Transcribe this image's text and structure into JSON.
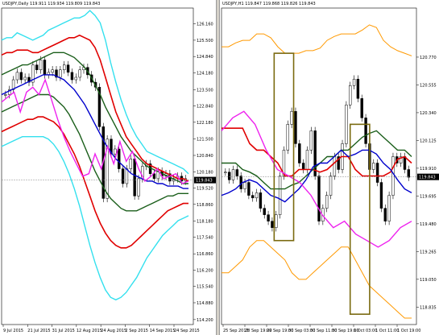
{
  "colors": {
    "background": "#ffffff",
    "candle": "#000000",
    "red": "#e00000",
    "darkred": "#cc0000",
    "green": "#1a5e1a",
    "blue": "#0000cc",
    "cyan": "#33e0ee",
    "magenta": "#ee22ee",
    "orange": "#ff9900",
    "olive": "#7a6a10",
    "grid": "#e6e6e6"
  },
  "chart_data": [
    {
      "type": "line",
      "title": "USDJPY,Daily  119.911 119.934 119.809 119.843",
      "x_labels": [
        "9 Jul 2015",
        "21 Jul 2015",
        "31 Jul 2015",
        "12 Aug 2015",
        "24 Aug 2015",
        "2 Sep 2015",
        "14 Sep 2015",
        "24 Sep 2015"
      ],
      "y_ticks": [
        "126.160",
        "125.500",
        "124.840",
        "124.180",
        "123.500",
        "122.840",
        "122.180",
        "121.500",
        "120.840",
        "120.180",
        "119.843",
        "119.520",
        "118.860",
        "118.180",
        "117.540",
        "116.860",
        "116.200",
        "115.540",
        "114.880",
        "114.200"
      ],
      "ylim": [
        114.0,
        126.8
      ],
      "current_price": "119.843",
      "close_series": [
        123.3,
        123.5,
        123.9,
        124.2,
        123.9,
        124.0,
        123.8,
        124.5,
        124.3,
        124.7,
        124.1,
        124.2,
        124.3,
        124.0,
        124.3,
        124.5,
        124.2,
        123.9,
        124.0,
        124.3,
        124.4,
        124.1,
        123.8,
        123.6,
        122.0,
        119.1,
        121.5,
        120.9,
        121.1,
        120.3,
        119.7,
        120.3,
        120.7,
        119.2,
        119.9,
        120.4,
        120.5,
        120.1,
        119.9,
        120.2,
        120.0,
        120.1,
        119.8,
        119.9,
        120.0,
        119.8,
        119.9
      ],
      "series": [
        {
          "name": "",
          "color_key": "cyan",
          "values": [
            125.5,
            125.6,
            125.6,
            125.8,
            125.7,
            125.6,
            125.5,
            125.6,
            125.7,
            125.9,
            126.0,
            126.1,
            126.2,
            126.3,
            126.4,
            126.4,
            126.5,
            126.7,
            126.5,
            126.2,
            125.5,
            124.6,
            123.8,
            123.1,
            122.5,
            122.0,
            121.6,
            121.3,
            121.0,
            120.9,
            120.8,
            120.7,
            120.6,
            120.5,
            120.4,
            120.3,
            120.1
          ]
        },
        {
          "name": "",
          "color_key": "red",
          "values": [
            124.9,
            125.0,
            125.0,
            125.1,
            125.1,
            125.1,
            125.0,
            125.0,
            125.1,
            125.2,
            125.3,
            125.4,
            125.5,
            125.6,
            125.6,
            125.7,
            125.6,
            125.5,
            125.2,
            124.7,
            124.0,
            123.3,
            122.6,
            122.1,
            121.6,
            121.3,
            121.0,
            120.7,
            120.5,
            120.4,
            120.3,
            120.2,
            120.1,
            120.0,
            119.9,
            119.9,
            119.8
          ]
        },
        {
          "name": "",
          "color_key": "green",
          "values": [
            124.1,
            124.2,
            124.3,
            124.4,
            124.5,
            124.5,
            124.6,
            124.7,
            124.8,
            124.9,
            125.0,
            125.0,
            125.0,
            124.9,
            124.8,
            124.6,
            124.4,
            124.1,
            123.7,
            123.3,
            122.8,
            122.4,
            122.0,
            121.6,
            121.3,
            121.0,
            120.8,
            120.6,
            120.4,
            120.3,
            120.2,
            120.1,
            120.0,
            119.9,
            119.8,
            119.7,
            119.7
          ]
        },
        {
          "name": "",
          "color_key": "blue",
          "values": [
            123.3,
            123.4,
            123.5,
            123.6,
            123.7,
            123.8,
            123.9,
            124.0,
            124.1,
            124.1,
            124.1,
            124.0,
            123.9,
            123.7,
            123.5,
            123.2,
            122.9,
            122.5,
            122.1,
            121.7,
            121.3,
            121.0,
            120.7,
            120.5,
            120.3,
            120.1,
            120.0,
            119.9,
            119.8,
            119.8,
            119.7,
            119.7,
            119.6,
            119.6,
            119.6,
            119.5,
            119.5
          ]
        },
        {
          "name": "",
          "color_key": "green",
          "values": [
            122.6,
            122.7,
            122.8,
            122.9,
            123.0,
            123.1,
            123.2,
            123.3,
            123.3,
            123.3,
            123.2,
            123.0,
            122.8,
            122.5,
            122.1,
            121.7,
            121.2,
            120.7,
            120.2,
            119.8,
            119.4,
            119.1,
            118.9,
            118.7,
            118.6,
            118.6,
            118.6,
            118.7,
            118.8,
            118.9,
            119.0,
            119.1,
            119.2,
            119.2,
            119.3,
            119.3,
            119.3
          ]
        },
        {
          "name": "",
          "color_key": "red",
          "values": [
            121.8,
            121.9,
            122.0,
            122.1,
            122.2,
            122.3,
            122.3,
            122.4,
            122.4,
            122.3,
            122.2,
            122.0,
            121.7,
            121.3,
            120.9,
            120.4,
            119.8,
            119.2,
            118.6,
            118.1,
            117.7,
            117.4,
            117.2,
            117.1,
            117.1,
            117.2,
            117.4,
            117.6,
            117.8,
            118.0,
            118.2,
            118.4,
            118.6,
            118.7,
            118.8,
            118.9,
            118.9
          ]
        },
        {
          "name": "",
          "color_key": "cyan",
          "values": [
            121.2,
            121.3,
            121.4,
            121.5,
            121.6,
            121.6,
            121.6,
            121.6,
            121.6,
            121.5,
            121.3,
            121.0,
            120.6,
            120.1,
            119.5,
            118.8,
            118.0,
            117.2,
            116.5,
            115.9,
            115.4,
            115.1,
            115.0,
            115.1,
            115.3,
            115.6,
            115.9,
            116.3,
            116.7,
            117.0,
            117.3,
            117.6,
            117.8,
            118.0,
            118.2,
            118.3,
            118.4
          ]
        },
        {
          "name": "",
          "color_key": "magenta",
          "values": [
            123.0,
            123.2,
            123.4,
            122.6,
            123.4,
            123.6,
            123.3,
            123.9,
            123.1,
            122.3,
            121.6,
            121.0,
            120.5,
            120.0,
            120.1,
            120.9,
            120.3,
            121.2,
            120.5,
            121.4,
            120.6,
            121.0,
            120.3,
            119.8,
            120.0,
            120.3,
            119.9,
            120.0,
            120.1,
            119.7,
            119.8
          ]
        }
      ]
    },
    {
      "type": "line",
      "title": "USDJPY,H1  119.847 119.868 119.826 119.843",
      "x_labels": [
        "25 Sep 2015",
        "28 Sep 19:00",
        "29 Sep 19:00",
        "30 Sep 03:00",
        "30 Sep 11:00",
        "30 Sep 19:00",
        "1 Oct 03:00",
        "1 Oct 11:00",
        "1 Oct 19:00"
      ],
      "y_ticks": [
        "120.770",
        "120.555",
        "120.340",
        "120.125",
        "119.910",
        "119.843",
        "119.695",
        "119.480",
        "119.265",
        "119.050",
        "118.835"
      ],
      "ylim": [
        118.7,
        121.15
      ],
      "current_price": "119.843",
      "close_series": [
        119.88,
        119.82,
        119.9,
        119.85,
        119.75,
        119.8,
        119.7,
        119.68,
        119.72,
        119.6,
        119.55,
        119.5,
        119.45,
        119.55,
        119.85,
        120.05,
        120.25,
        120.35,
        120.1,
        119.95,
        119.9,
        120.05,
        120.2,
        119.85,
        119.5,
        119.6,
        119.7,
        119.85,
        120.0,
        119.9,
        120.1,
        120.4,
        120.55,
        120.6,
        120.45,
        120.3,
        120.1,
        119.9,
        119.95,
        119.8,
        119.6,
        119.5,
        119.7,
        120.0,
        119.95,
        120.0,
        119.9,
        119.84
      ],
      "series": [
        {
          "name": "",
          "color_key": "orange",
          "values": [
            120.85,
            120.85,
            120.88,
            120.9,
            120.9,
            120.95,
            120.95,
            120.92,
            120.85,
            120.8,
            120.8,
            120.8,
            120.82,
            120.82,
            120.84,
            120.9,
            120.93,
            120.95,
            120.95,
            120.95,
            120.98,
            121.02,
            121.0,
            120.9,
            120.85,
            120.82,
            120.8,
            120.78
          ]
        },
        {
          "name": "",
          "color_key": "red",
          "values": [
            120.22,
            120.22,
            120.22,
            120.22,
            120.1,
            120.05,
            120.05,
            120.0,
            119.95,
            119.85,
            119.85,
            119.9,
            119.9,
            119.9,
            119.88,
            119.9,
            119.95,
            120.0,
            120.0,
            119.9,
            119.85,
            119.85,
            119.85,
            119.85,
            119.88,
            119.98,
            120.0,
            119.95
          ]
        },
        {
          "name": "",
          "color_key": "green",
          "values": [
            119.95,
            119.95,
            119.95,
            119.9,
            119.88,
            119.85,
            119.8,
            119.75,
            119.75,
            119.75,
            119.78,
            119.8,
            119.85,
            119.9,
            119.95,
            120.0,
            120.0,
            120.05,
            120.05,
            120.1,
            120.15,
            120.18,
            120.2,
            120.15,
            120.1,
            120.05,
            120.05,
            120.0
          ]
        },
        {
          "name": "",
          "color_key": "blue",
          "values": [
            119.7,
            119.72,
            119.75,
            119.8,
            119.82,
            119.8,
            119.75,
            119.7,
            119.68,
            119.65,
            119.7,
            119.75,
            119.82,
            119.92,
            119.95,
            119.95,
            120.0,
            120.05,
            120.0,
            120.02,
            120.05,
            120.05,
            120.02,
            119.95,
            119.9,
            119.82,
            119.75,
            119.72
          ]
        },
        {
          "name": "",
          "color_key": "orange",
          "values": [
            119.1,
            119.1,
            119.15,
            119.2,
            119.3,
            119.35,
            119.35,
            119.3,
            119.25,
            119.2,
            119.1,
            119.05,
            119.05,
            119.1,
            119.15,
            119.2,
            119.25,
            119.3,
            119.3,
            119.2,
            119.1,
            119.0,
            118.95,
            118.9,
            118.85,
            118.8,
            118.75,
            118.75
          ]
        },
        {
          "name": "",
          "color_key": "magenta",
          "values": [
            120.2,
            120.3,
            120.35,
            120.25,
            120.05,
            119.9,
            119.85,
            119.8,
            119.7,
            119.55,
            119.45,
            119.5,
            119.4,
            119.35,
            119.3,
            119.35,
            119.45,
            119.5
          ]
        }
      ],
      "boxes": [
        {
          "x0": 0.27,
          "x1": 0.37,
          "y0": 120.8,
          "y1": 119.35
        },
        {
          "x0": 0.66,
          "x1": 0.76,
          "y0": 120.25,
          "y1": 118.78
        }
      ]
    }
  ]
}
